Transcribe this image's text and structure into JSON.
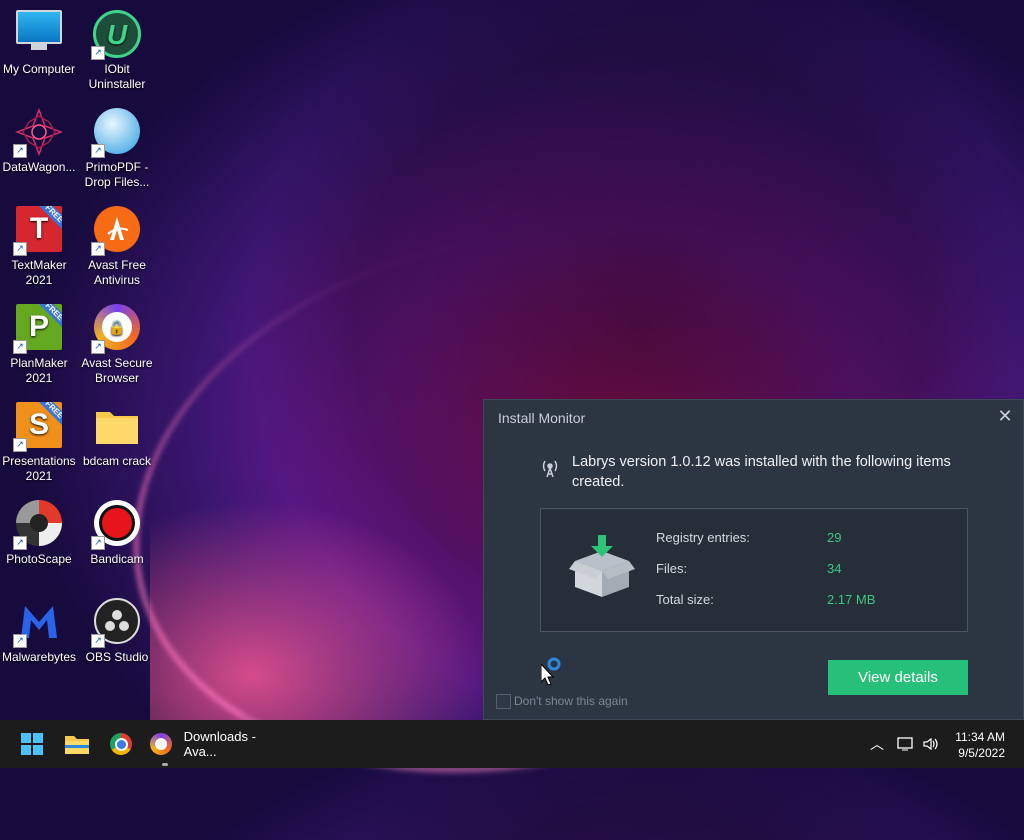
{
  "desktop": {
    "icons": [
      {
        "label": "My Computer",
        "icon": "computer-icon"
      },
      {
        "label": "IObit\nUninstaller",
        "icon": "iobit-uninstaller-icon"
      },
      {
        "label": "DataWagon...",
        "icon": "datawagon-icon"
      },
      {
        "label": "PrimoPDF -\nDrop Files...",
        "icon": "primopdf-icon"
      },
      {
        "label": "TextMaker\n2021",
        "icon": "textmaker-icon"
      },
      {
        "label": "Avast Free\nAntivirus",
        "icon": "avast-antivirus-icon"
      },
      {
        "label": "PlanMaker\n2021",
        "icon": "planmaker-icon"
      },
      {
        "label": "Avast Secure\nBrowser",
        "icon": "avast-browser-icon"
      },
      {
        "label": "Presentations\n2021",
        "icon": "presentations-icon"
      },
      {
        "label": "bdcam crack",
        "icon": "folder-icon"
      },
      {
        "label": "PhotoScape",
        "icon": "photoscape-icon"
      },
      {
        "label": "Bandicam",
        "icon": "bandicam-icon"
      },
      {
        "label": "Malwarebytes",
        "icon": "malwarebytes-icon"
      },
      {
        "label": "OBS Studio",
        "icon": "obs-studio-icon"
      }
    ],
    "free_badge": "FREE",
    "tile_letters": {
      "textmaker": "T",
      "planmaker": "P",
      "presentations": "S",
      "iobit": "U"
    }
  },
  "dialog": {
    "title": "Install Monitor",
    "message": "Labrys version 1.0.12 was installed with the following items created.",
    "stats": [
      {
        "label": "Registry entries:",
        "value": "29"
      },
      {
        "label": "Files:",
        "value": "34"
      },
      {
        "label": "Total size:",
        "value": "2.17 MB"
      }
    ],
    "dont_show": "Don't show this again",
    "view_details": "View details",
    "accent": "#27c07a"
  },
  "taskbar": {
    "active_window": "Downloads - Ava...",
    "time": "11:34 AM",
    "date": "9/5/2022"
  }
}
